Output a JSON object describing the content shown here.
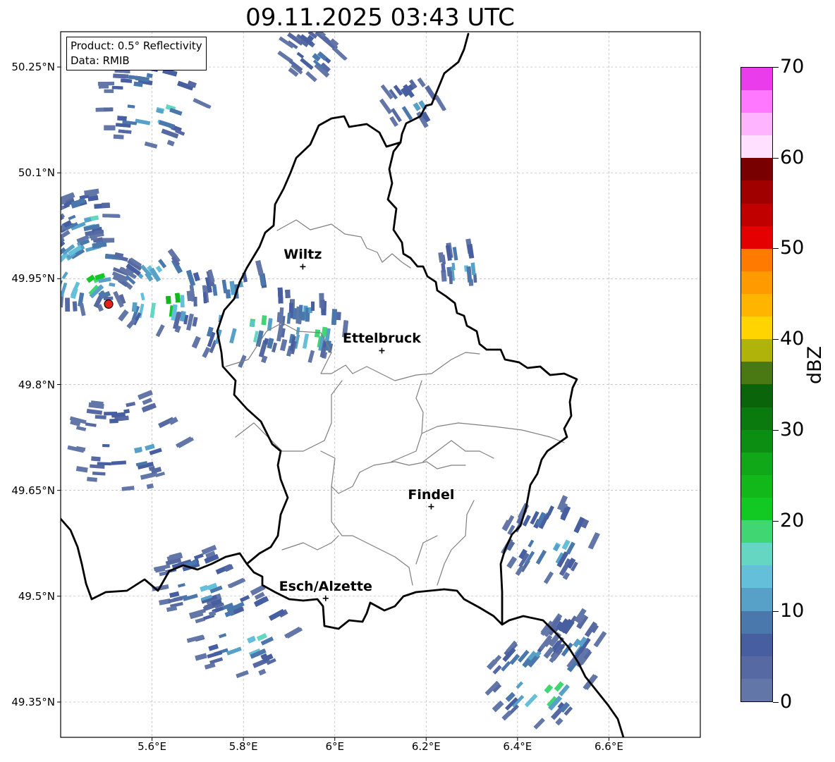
{
  "title": "09.11.2025 03:43 UTC",
  "info": {
    "product": "Product: 0.5° Reflectivity",
    "data": "Data: RMIB"
  },
  "lon_ticks": [
    {
      "lon": 5.6,
      "label": "5.6°E"
    },
    {
      "lon": 5.8,
      "label": "5.8°E"
    },
    {
      "lon": 6.0,
      "label": "6°E"
    },
    {
      "lon": 6.2,
      "label": "6.2°E"
    },
    {
      "lon": 6.4,
      "label": "6.4°E"
    },
    {
      "lon": 6.6,
      "label": "6.6°E"
    }
  ],
  "lat_ticks": [
    {
      "lat": 50.25,
      "label": "50.25°N"
    },
    {
      "lat": 50.1,
      "label": "50.1°N"
    },
    {
      "lat": 49.95,
      "label": "49.95°N"
    },
    {
      "lat": 49.8,
      "label": "49.8°N"
    },
    {
      "lat": 49.65,
      "label": "49.65°N"
    },
    {
      "lat": 49.5,
      "label": "49.5°N"
    },
    {
      "lat": 49.35,
      "label": "49.35°N"
    }
  ],
  "cities": [
    {
      "name": "Wiltz",
      "lon": 5.93,
      "lat": 49.967
    },
    {
      "name": "Ettelbruck",
      "lon": 6.103,
      "lat": 49.848
    },
    {
      "name": "Findel",
      "lon": 6.211,
      "lat": 49.627
    },
    {
      "name": "Esch/Alzette",
      "lon": 5.98,
      "lat": 49.497
    }
  ],
  "radar_site": {
    "lon": 5.505,
    "lat": 49.914,
    "color": "#e8201a"
  },
  "colorbar": {
    "unit": "dBZ",
    "min": 0,
    "max": 70,
    "step": 2.5,
    "tick_labels": [
      "0",
      "10",
      "20",
      "30",
      "40",
      "50",
      "60",
      "70"
    ],
    "colors": [
      "#6276a8",
      "#5669a2",
      "#475fa0",
      "#4a78ad",
      "#57a0c8",
      "#64c0da",
      "#64d6c2",
      "#40d672",
      "#12c822",
      "#12b81a",
      "#10a818",
      "#0c8e12",
      "#0a7a0e",
      "#0a640a",
      "#4a7812",
      "#b0b40a",
      "#ffd400",
      "#ffb400",
      "#ff9a00",
      "#ff7a00",
      "#e40000",
      "#c00000",
      "#a00000",
      "#780000",
      "#ffe0ff",
      "#ffb4ff",
      "#ff78ff",
      "#ea3cea"
    ]
  },
  "extent": {
    "lon_min": 5.4,
    "lon_max": 6.8,
    "lat_min": 49.3,
    "lat_max": 50.3
  },
  "echoes": [
    {
      "lon": 5.45,
      "lat": 49.96,
      "r": 0.08,
      "n": 140,
      "max_dbz": 35
    },
    {
      "lon": 5.62,
      "lat": 49.93,
      "r": 0.08,
      "n": 110,
      "max_dbz": 40
    },
    {
      "lon": 5.8,
      "lat": 49.9,
      "r": 0.1,
      "n": 160,
      "max_dbz": 30
    },
    {
      "lon": 5.95,
      "lat": 49.88,
      "r": 0.06,
      "n": 70,
      "max_dbz": 32
    },
    {
      "lon": 5.6,
      "lat": 50.2,
      "r": 0.09,
      "n": 110,
      "max_dbz": 25
    },
    {
      "lon": 5.45,
      "lat": 50.04,
      "r": 0.05,
      "n": 40,
      "max_dbz": 25
    },
    {
      "lon": 5.95,
      "lat": 50.27,
      "r": 0.05,
      "n": 30,
      "max_dbz": 15
    },
    {
      "lon": 6.45,
      "lat": 49.38,
      "r": 0.09,
      "n": 260,
      "max_dbz": 32
    },
    {
      "lon": 6.47,
      "lat": 49.58,
      "r": 0.08,
      "n": 150,
      "max_dbz": 22
    },
    {
      "lon": 6.52,
      "lat": 49.44,
      "r": 0.05,
      "n": 60,
      "max_dbz": 20
    },
    {
      "lon": 5.8,
      "lat": 49.45,
      "r": 0.09,
      "n": 140,
      "max_dbz": 25
    },
    {
      "lon": 5.55,
      "lat": 49.72,
      "r": 0.1,
      "n": 50,
      "max_dbz": 18
    },
    {
      "lon": 6.28,
      "lat": 49.97,
      "r": 0.04,
      "n": 20,
      "max_dbz": 30
    },
    {
      "lon": 6.17,
      "lat": 50.2,
      "r": 0.05,
      "n": 20,
      "max_dbz": 20
    },
    {
      "lon": 5.7,
      "lat": 49.52,
      "r": 0.07,
      "n": 50,
      "max_dbz": 22
    }
  ]
}
